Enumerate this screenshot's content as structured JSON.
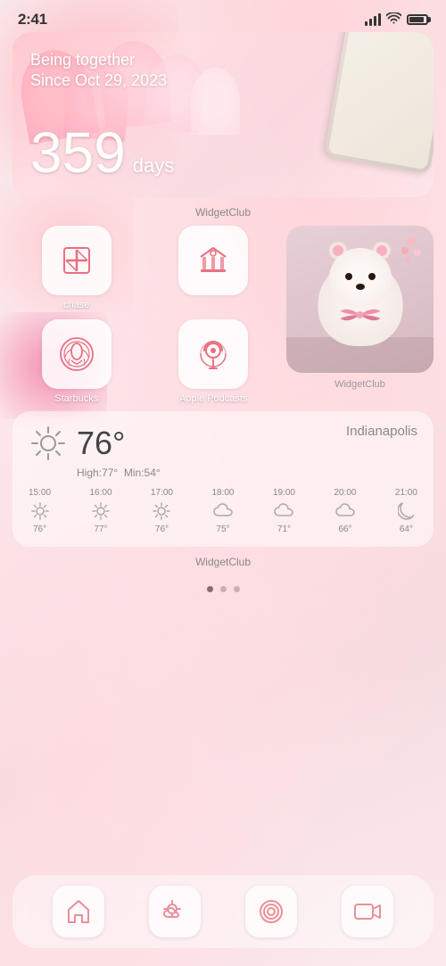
{
  "status": {
    "time": "2:41"
  },
  "love_widget": {
    "title_line1": "Being together",
    "title_line2": "Since Oct 29, 2023",
    "days_count": "359",
    "days_label": "days",
    "widget_credit": "WidgetClub"
  },
  "app_grid": {
    "apps": [
      {
        "name": "chase",
        "label": "chase"
      },
      {
        "name": "bank",
        "label": ""
      },
      {
        "name": "starbucks",
        "label": "Starbucks"
      },
      {
        "name": "podcasts",
        "label": "Apple Podcasts"
      }
    ],
    "photo_widget_credit": "WidgetClub"
  },
  "weather": {
    "city": "Indianapolis",
    "temp": "76°",
    "high": "High:77°",
    "min": "Min:54°",
    "widget_credit": "WidgetClub",
    "hourly": [
      {
        "time": "15:00",
        "icon": "sun",
        "temp": "76°"
      },
      {
        "time": "16:00",
        "icon": "sun",
        "temp": "77°"
      },
      {
        "time": "17:00",
        "icon": "sun",
        "temp": "76°"
      },
      {
        "time": "18:00",
        "icon": "cloud",
        "temp": "75°"
      },
      {
        "time": "19:00",
        "icon": "cloud",
        "temp": "71°"
      },
      {
        "time": "20:00",
        "icon": "cloud",
        "temp": "66°"
      },
      {
        "time": "21:00",
        "icon": "moon",
        "temp": "64°"
      }
    ]
  },
  "dock": {
    "items": [
      {
        "name": "home",
        "icon": "house"
      },
      {
        "name": "weather",
        "icon": "cloud-sun"
      },
      {
        "name": "target",
        "icon": "target"
      },
      {
        "name": "camera",
        "icon": "video"
      }
    ]
  },
  "page_dots": {
    "count": 3,
    "active": 0
  }
}
